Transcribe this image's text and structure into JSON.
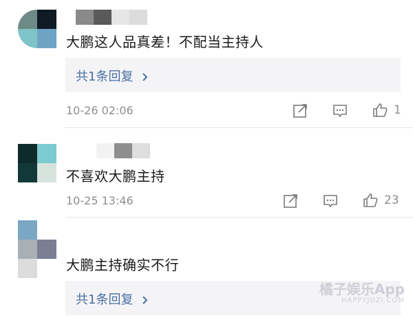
{
  "comments": [
    {
      "text": "大鹏这人品真差！不配当主持人",
      "reply_label": "共1条回复",
      "time": "10-26 02:06",
      "likes": "1"
    },
    {
      "text": "不喜欢大鹏主持",
      "time": "10-25 13:46",
      "likes": "23"
    },
    {
      "text": "大鹏主持确实不行",
      "reply_label": "共1条回复"
    }
  ],
  "watermark": {
    "main": "橘子娱乐App",
    "sub": "HAPPYJUZI.COM"
  },
  "colors": {
    "link": "#4a6fa5",
    "meta": "#8e8e8e",
    "reply_bg": "#f4f4f6"
  },
  "icons": [
    "share-icon",
    "comment-icon",
    "like-icon",
    "chevron-right-icon"
  ]
}
